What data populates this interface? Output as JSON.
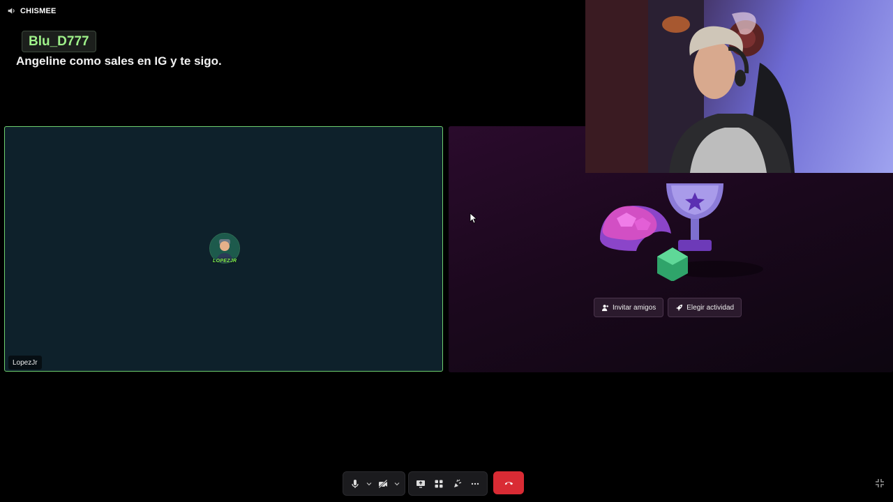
{
  "header": {
    "channel_name": "CHISMEE",
    "icon": "speaker-icon"
  },
  "chat": {
    "username": "Blu_D777",
    "message": "Angeline como sales en IG y te sigo."
  },
  "participant": {
    "name": "LopezJr",
    "avatar_tag": "LOPEZJR"
  },
  "activity": {
    "invite_label": "Invitar amigos",
    "choose_label": "Elegir actividad"
  },
  "toolbar": {
    "icons": [
      "microphone-icon",
      "chevron-down-icon",
      "camera-off-icon",
      "chevron-down-icon",
      "screen-share-icon",
      "activities-icon",
      "soundboard-icon",
      "more-icon",
      "hang-up-icon"
    ]
  },
  "colors": {
    "speaking_border": "#6fd16f",
    "hangup": "#d92b34",
    "username": "#9ff28a"
  }
}
